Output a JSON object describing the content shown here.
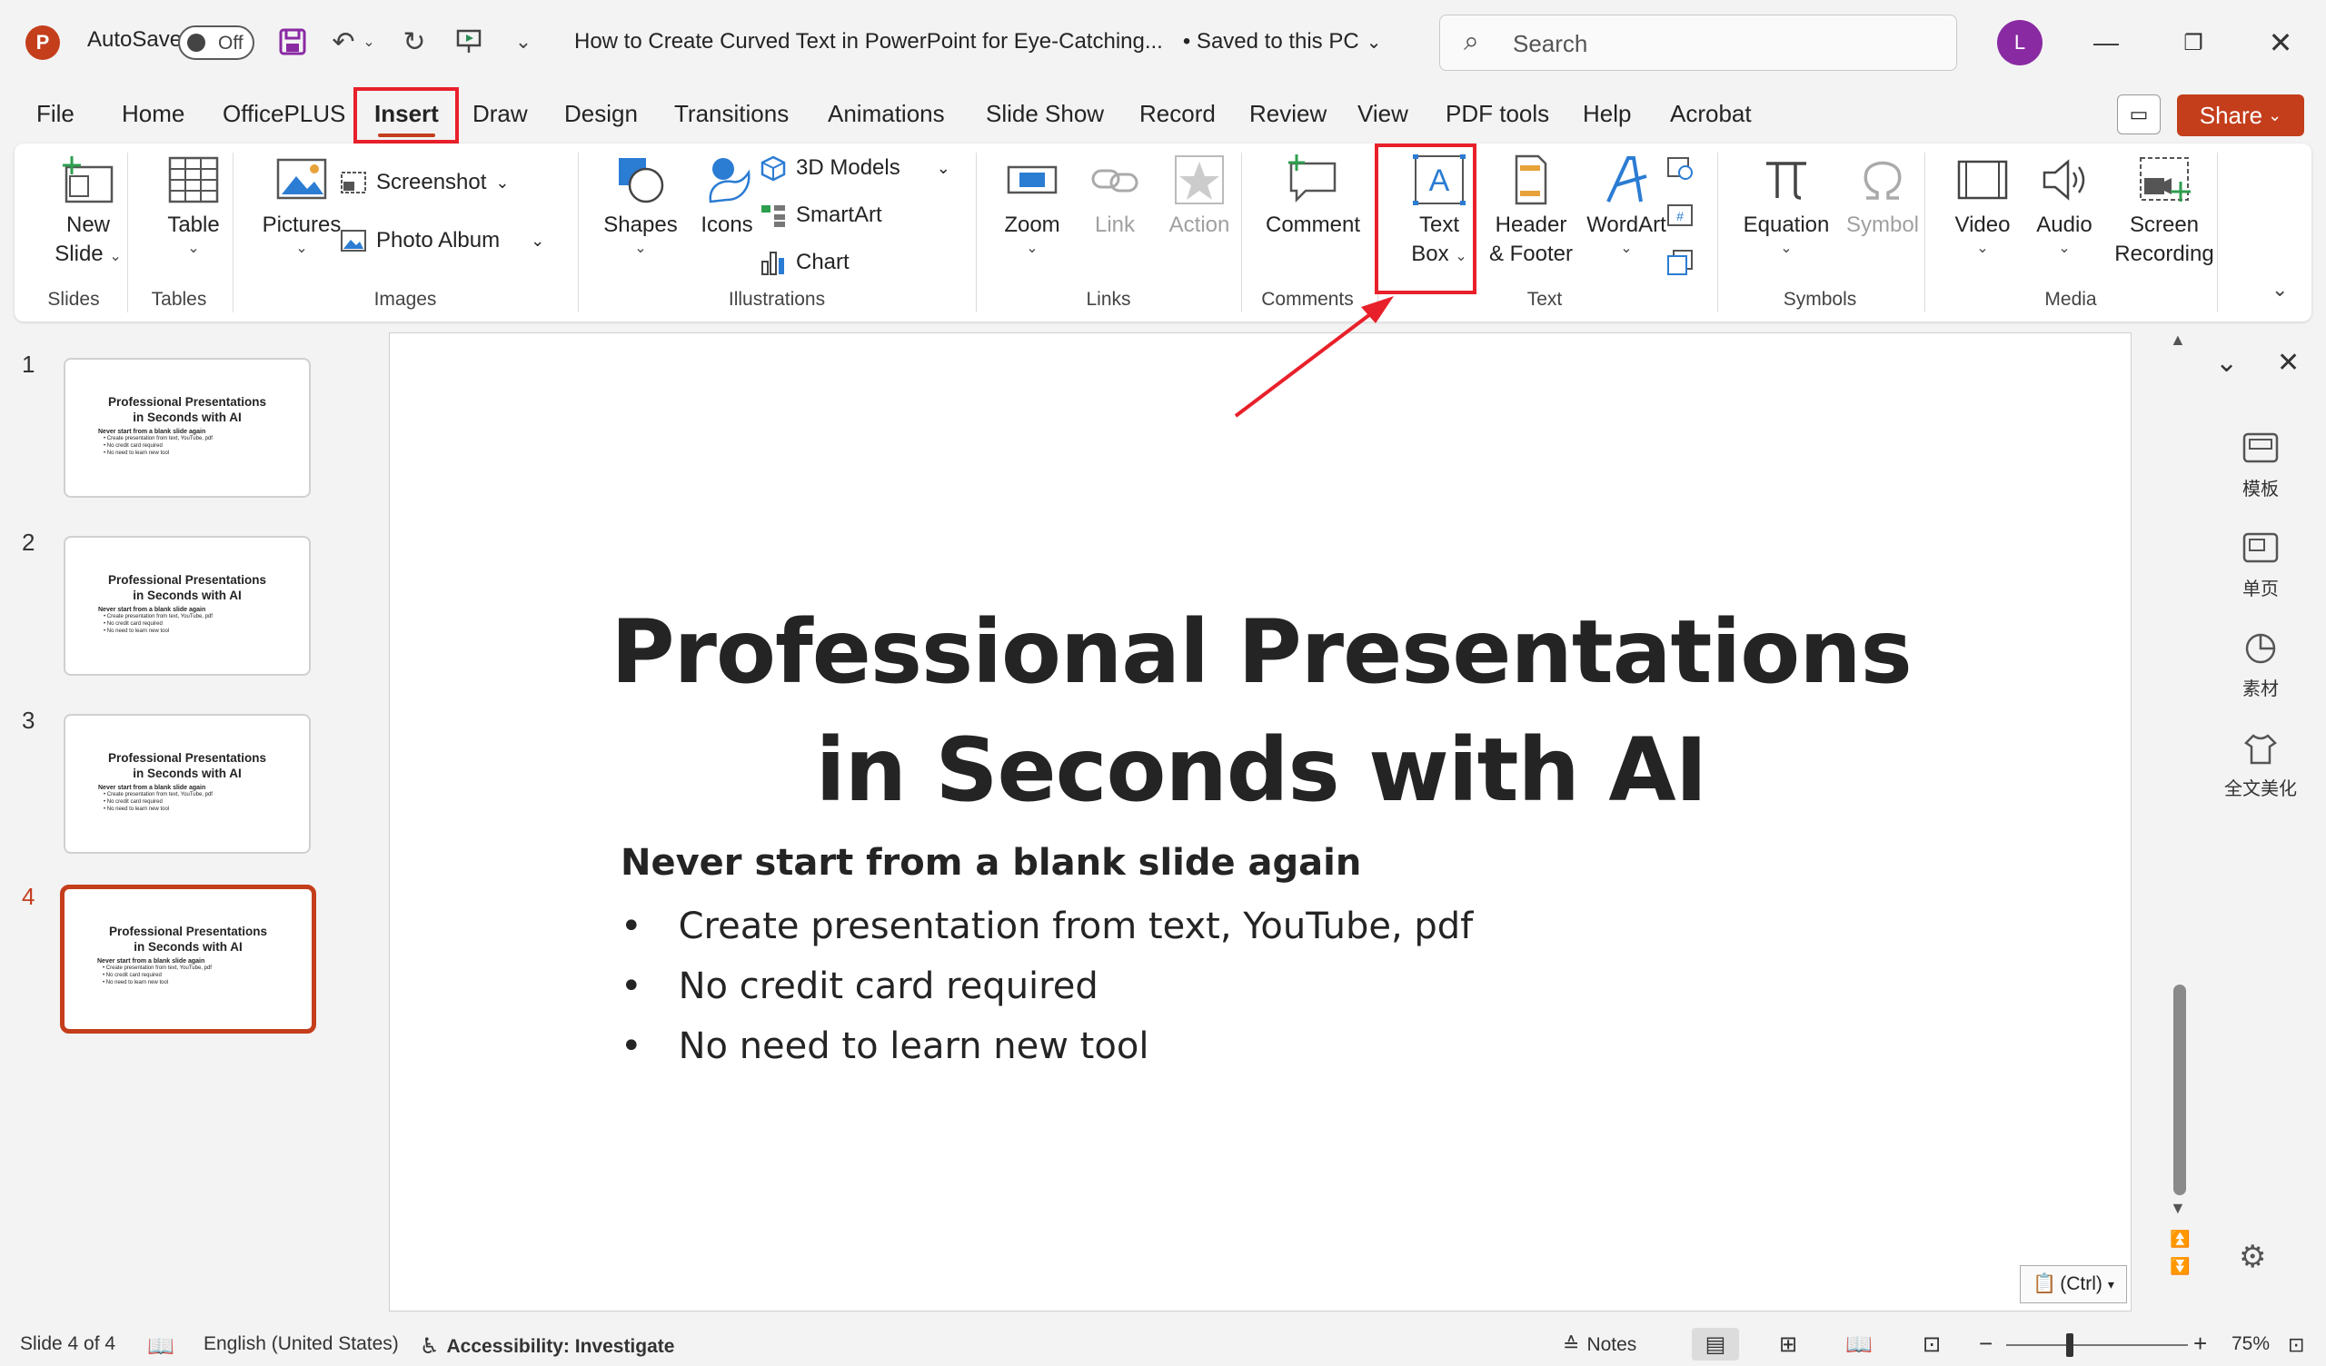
{
  "titlebar": {
    "app_icon": "powerpoint-icon",
    "autosave_label": "AutoSave",
    "autosave_state": "Off",
    "document_title": "How to Create Curved Text in PowerPoint for Eye-Catching...",
    "save_status": "• Saved to this PC",
    "search_placeholder": "Search",
    "user_initial": "L",
    "user_avatar_color": "#8a2aa3"
  },
  "menu": {
    "tabs": [
      "File",
      "Home",
      "OfficePLUS",
      "Insert",
      "Draw",
      "Design",
      "Transitions",
      "Animations",
      "Slide Show",
      "Record",
      "Review",
      "View",
      "PDF tools",
      "Help",
      "Acrobat"
    ],
    "active_tab": "Insert",
    "share_label": "Share"
  },
  "ribbon": {
    "groups": {
      "slides": "Slides",
      "tables": "Tables",
      "images": "Images",
      "illustrations": "Illustrations",
      "links": "Links",
      "comments": "Comments",
      "text": "Text",
      "symbols": "Symbols",
      "media": "Media"
    },
    "new_slide": {
      "line1": "New",
      "line2": "Slide"
    },
    "table": "Table",
    "pictures": "Pictures",
    "screenshot": "Screenshot",
    "photo_album": "Photo Album",
    "shapes": "Shapes",
    "icons": "Icons",
    "models_3d": "3D Models",
    "smartart": "SmartArt",
    "chart": "Chart",
    "zoom": "Zoom",
    "link": "Link",
    "action": "Action",
    "comment": "Comment",
    "text_box": {
      "line1": "Text",
      "line2": "Box"
    },
    "header_footer": {
      "line1": "Header",
      "line2": "& Footer"
    },
    "wordart": "WordArt",
    "equation": "Equation",
    "symbol": "Symbol",
    "video": "Video",
    "audio": "Audio",
    "screen_recording": {
      "line1": "Screen",
      "line2": "Recording"
    }
  },
  "thumbnails": [
    {
      "number": "1",
      "current": false
    },
    {
      "number": "2",
      "current": false
    },
    {
      "number": "3",
      "current": false
    },
    {
      "number": "4",
      "current": true
    }
  ],
  "slide": {
    "title_line1": "Professional Presentations",
    "title_line2": "in Seconds with AI",
    "subtitle": "Never start from a blank slide again",
    "bullets": [
      "Create presentation from text, YouTube, pdf",
      "No credit card required",
      "No need to learn new tool"
    ],
    "paste_options": "(Ctrl)"
  },
  "right_pane": {
    "items": [
      "模板",
      "单页",
      "素材",
      "全文美化"
    ]
  },
  "statusbar": {
    "slide_info": "Slide 4 of 4",
    "language": "English (United States)",
    "accessibility": "Accessibility: Investigate",
    "notes": "Notes",
    "zoom_level": "75%"
  },
  "colors": {
    "accent": "#c43e1c",
    "highlight_box": "#e8202a",
    "icon_blue": "#2b7cd3"
  }
}
